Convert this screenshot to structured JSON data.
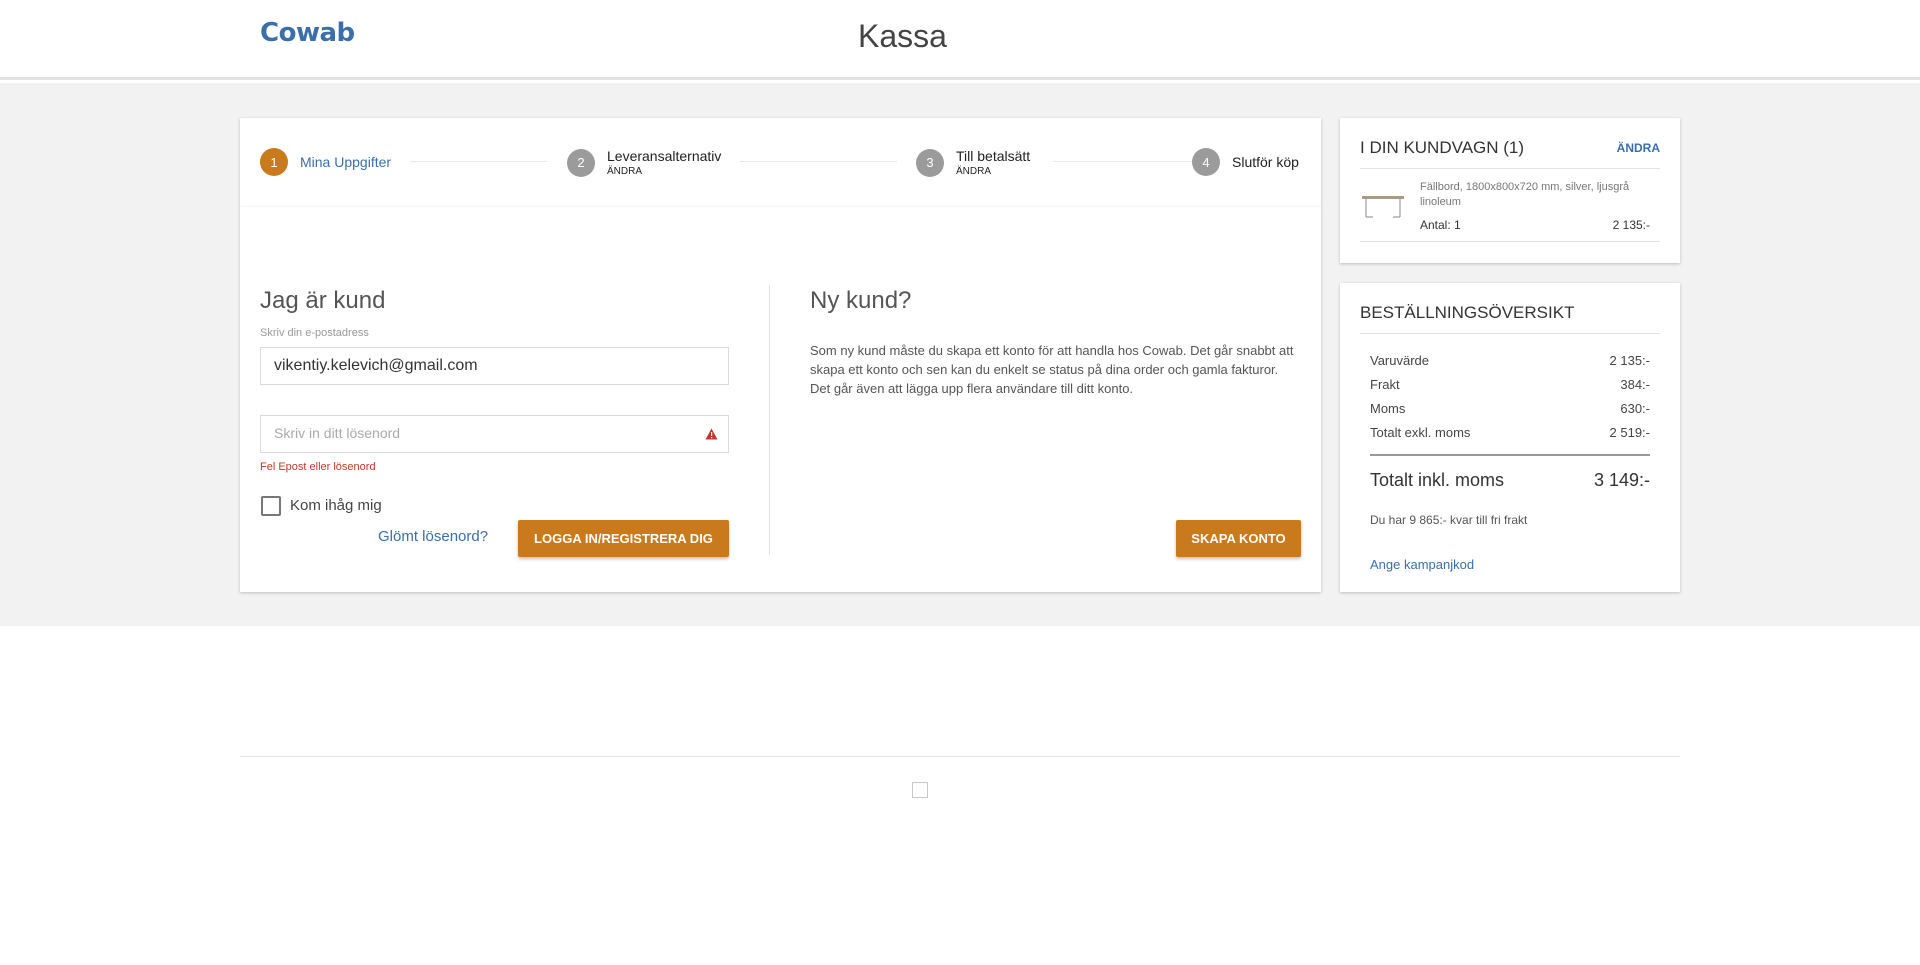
{
  "header": {
    "logo": "Cowab",
    "title": "Kassa"
  },
  "steps": [
    {
      "num": "1",
      "label": "Mina Uppgifter",
      "sub": ""
    },
    {
      "num": "2",
      "label": "Leveransalternativ",
      "sub": "ÄNDRA"
    },
    {
      "num": "3",
      "label": "Till betalsätt",
      "sub": "ÄNDRA"
    },
    {
      "num": "4",
      "label": "Slutför köp",
      "sub": ""
    }
  ],
  "login": {
    "heading": "Jag är kund",
    "email_label": "Skriv din e-postadress",
    "email_value": "vikentiy.kelevich@gmail.com",
    "password_placeholder": "Skriv in ditt lösenord",
    "error": "Fel Epost eller lösenord",
    "remember": "Kom ihåg mig",
    "forgot": "Glömt lösenord?",
    "submit": "LOGGA IN/REGISTRERA DIG"
  },
  "new_customer": {
    "heading": "Ny kund?",
    "text": "Som ny kund måste du skapa ett konto för att handla hos Cowab. Det går snabbt att skapa ett konto och sen kan du enkelt se status på dina order och gamla fakturor. Det går även att lägga upp flera användare till ditt konto.",
    "button": "SKAPA KONTO"
  },
  "cart": {
    "title": "I DIN KUNDVAGN (1)",
    "change": "ÄNDRA",
    "item_name": "Fällbord, 1800x800x720 mm, silver, ljusgrå linoleum",
    "item_qty": "Antal: 1",
    "item_price": "2 135:-"
  },
  "summary": {
    "title": "BESTÄLLNINGSÖVERSIKT",
    "rows": [
      {
        "label": "Varuvärde",
        "value": "2 135:-"
      },
      {
        "label": "Frakt",
        "value": "384:-"
      },
      {
        "label": "Moms",
        "value": "630:-"
      },
      {
        "label": "Totalt exkl. moms",
        "value": "2 519:-"
      }
    ],
    "total_label": "Totalt inkl. moms",
    "total_value": "3 149:-",
    "free_shipping": "Du har 9 865:- kvar till fri frakt",
    "campaign": "Ange kampanjkod"
  },
  "colors": {
    "accent": "#c97a1d",
    "link": "#3a6fa9",
    "error": "#c0392b"
  }
}
